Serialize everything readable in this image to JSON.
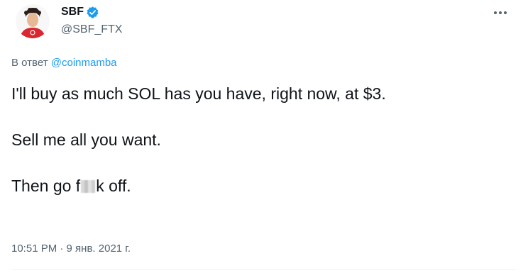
{
  "author": {
    "display_name": "SBF",
    "handle": "@SBF_FTX",
    "verified": true,
    "avatar_icon": "avatar-icon",
    "accent": "#1d9bf0"
  },
  "reply": {
    "prefix": "В ответ",
    "mention": "@coinmamba"
  },
  "tweet": {
    "line1": "I'll buy as much SOL has you have, right now, at $3.",
    "line2": "Sell me all you want.",
    "line3_start": "Then go f",
    "line3_end": "k off."
  },
  "meta": {
    "timestamp": "10:51 PM · 9 янв. 2021 г."
  }
}
